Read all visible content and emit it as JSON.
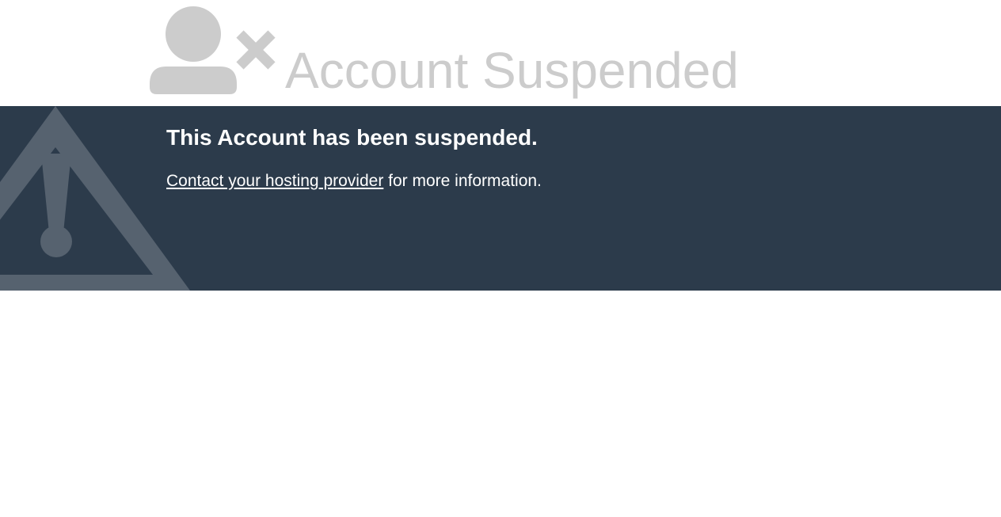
{
  "header": {
    "title": "Account Suspended",
    "icon": "user-x-icon",
    "title_color": "#cccccc"
  },
  "banner": {
    "background_color": "#2c3b4b",
    "icon": "warning-triangle-icon",
    "heading": "This Account has been suspended.",
    "contact_link": "Contact your hosting provider",
    "message_suffix": " for more information."
  }
}
